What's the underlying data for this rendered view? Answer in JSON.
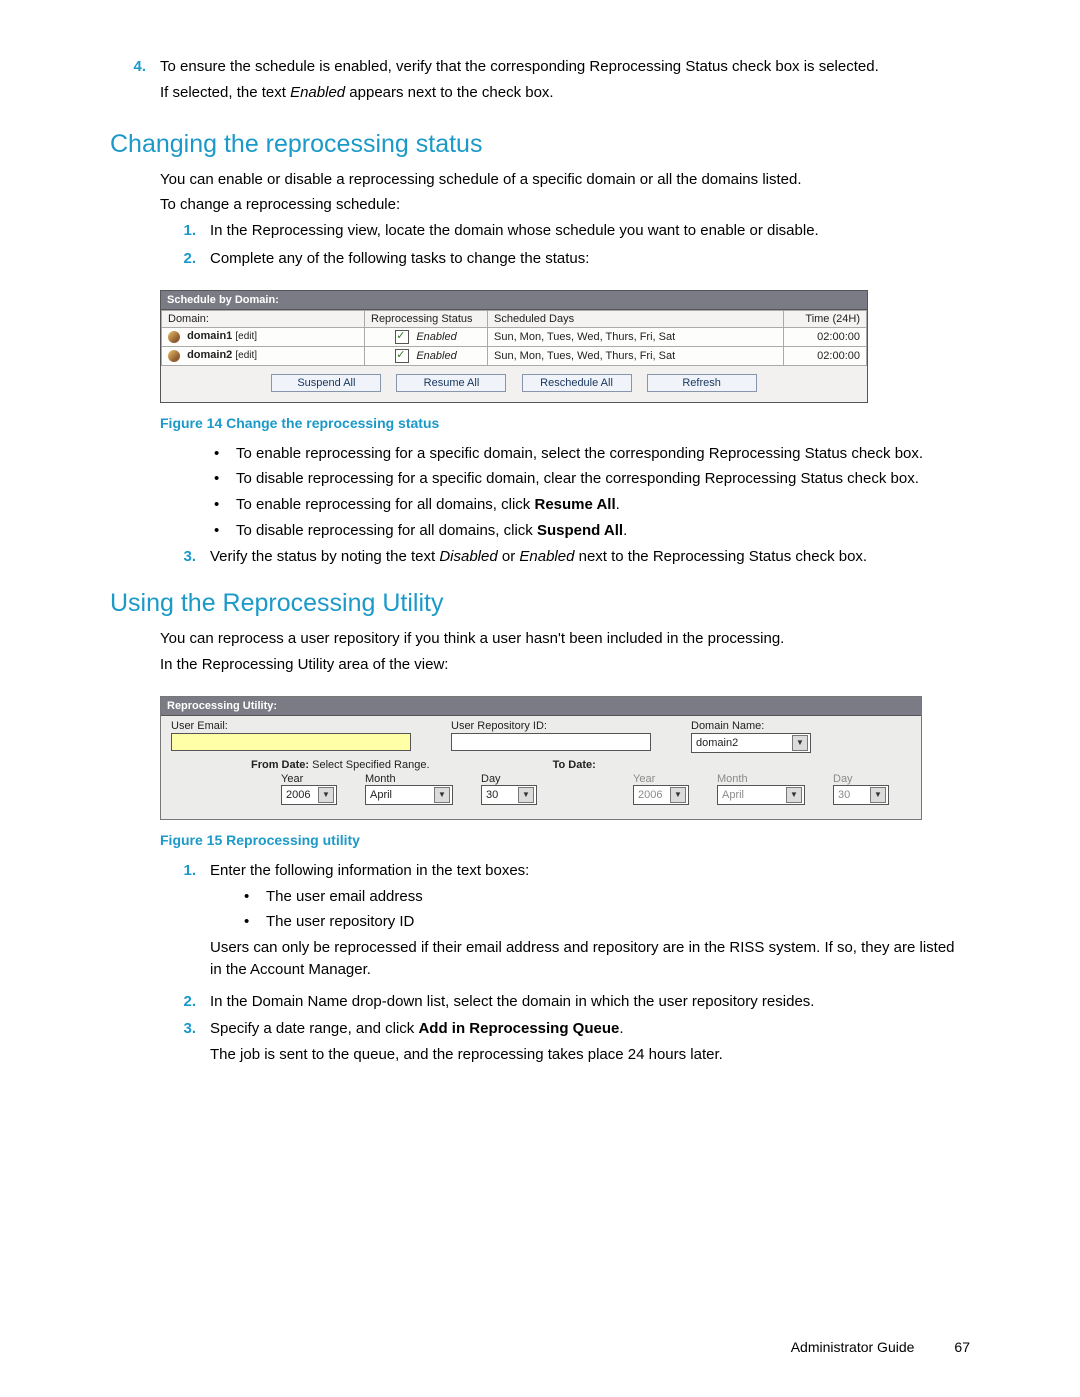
{
  "step4": {
    "num": "4.",
    "text_a": "To ensure the schedule is enabled, verify that the corresponding Reprocessing Status check box is selected.",
    "text_b1": "If selected, the text ",
    "text_b_it": "Enabled",
    "text_b2": " appears next to the check box."
  },
  "h_changing": "Changing the reprocessing status",
  "changing_p1": "You can enable or disable a reprocessing schedule of a specific domain or all the domains listed.",
  "changing_p2": "To change a reprocessing schedule:",
  "change_steps": [
    {
      "n": "1.",
      "t": "In the Reprocessing view, locate the domain whose schedule you want to enable or disable."
    },
    {
      "n": "2.",
      "t": "Complete any of the following tasks to change the status:"
    }
  ],
  "fig14": {
    "title": "Schedule by Domain:",
    "cols": {
      "domain": "Domain:",
      "status": "Reprocessing Status",
      "days": "Scheduled Days",
      "time": "Time (24H)"
    },
    "rows": [
      {
        "domain": "domain1",
        "edit": "[edit]",
        "enabled": true,
        "enabled_lbl": "Enabled",
        "days": "Sun, Mon, Tues, Wed, Thurs, Fri, Sat",
        "time": "02:00:00"
      },
      {
        "domain": "domain2",
        "edit": "[edit]",
        "enabled": true,
        "enabled_lbl": "Enabled",
        "days": "Sun, Mon, Tues, Wed, Thurs, Fri, Sat",
        "time": "02:00:00"
      }
    ],
    "buttons": {
      "suspend": "Suspend All",
      "resume": "Resume All",
      "reschedule": "Reschedule All",
      "refresh": "Refresh"
    }
  },
  "cap14": "Figure 14 Change the reprocessing status",
  "bullets1": [
    {
      "pre": "To enable reprocessing for a specific domain, select the corresponding Reprocessing Status check box."
    },
    {
      "pre": "To disable reprocessing for a specific domain, clear the corresponding Reprocessing Status check box."
    },
    {
      "pre": "To enable reprocessing for all domains, click ",
      "bold": "Resume All",
      "post": "."
    },
    {
      "pre": "To disable reprocessing for all domains, click ",
      "bold": "Suspend All",
      "post": "."
    }
  ],
  "step3_verify": {
    "n": "3.",
    "t1": "Verify the status by noting the text ",
    "it1": "Disabled",
    "t2": " or ",
    "it2": "Enabled",
    "t3": " next to the Reprocessing Status check box."
  },
  "h_util": "Using the Reprocessing Utility",
  "util_p1": "You can reprocess a user repository if you think a user hasn't been included in the processing.",
  "util_p2": "In the Reprocessing Utility area of the view:",
  "fig15": {
    "title": "Reprocessing Utility:",
    "user_email": "User Email:",
    "repo": "User Repository ID:",
    "domain_lbl": "Domain Name:",
    "domain_val": "domain2",
    "from_date": "From Date:",
    "select_range": "Select Specified Range.",
    "to_date": "To Date:",
    "year": "Year",
    "month": "Month",
    "day": "Day",
    "from": {
      "year": "2006",
      "month": "April",
      "day": "30"
    },
    "to": {
      "year": "2006",
      "month": "April",
      "day": "30"
    }
  },
  "cap15": "Figure 15 Reprocessing utility",
  "util_steps": {
    "s1": {
      "n": "1.",
      "t": "Enter the following information in the text boxes:",
      "b1": "The user email address",
      "b2": "The user repository ID",
      "p": "Users can only be reprocessed if their email address and repository are in the RISS system. If so, they are listed in the Account Manager."
    },
    "s2": {
      "n": "2.",
      "t": "In the Domain Name drop-down list, select the domain in which the user repository resides."
    },
    "s3": {
      "n": "3.",
      "t1": "Specify a date range, and click ",
      "b": "Add in Reprocessing Queue",
      "t2": ".",
      "p": "The job is sent to the queue, and the reprocessing takes place 24 hours later."
    }
  },
  "footer": {
    "title": "Administrator Guide",
    "page": "67"
  }
}
